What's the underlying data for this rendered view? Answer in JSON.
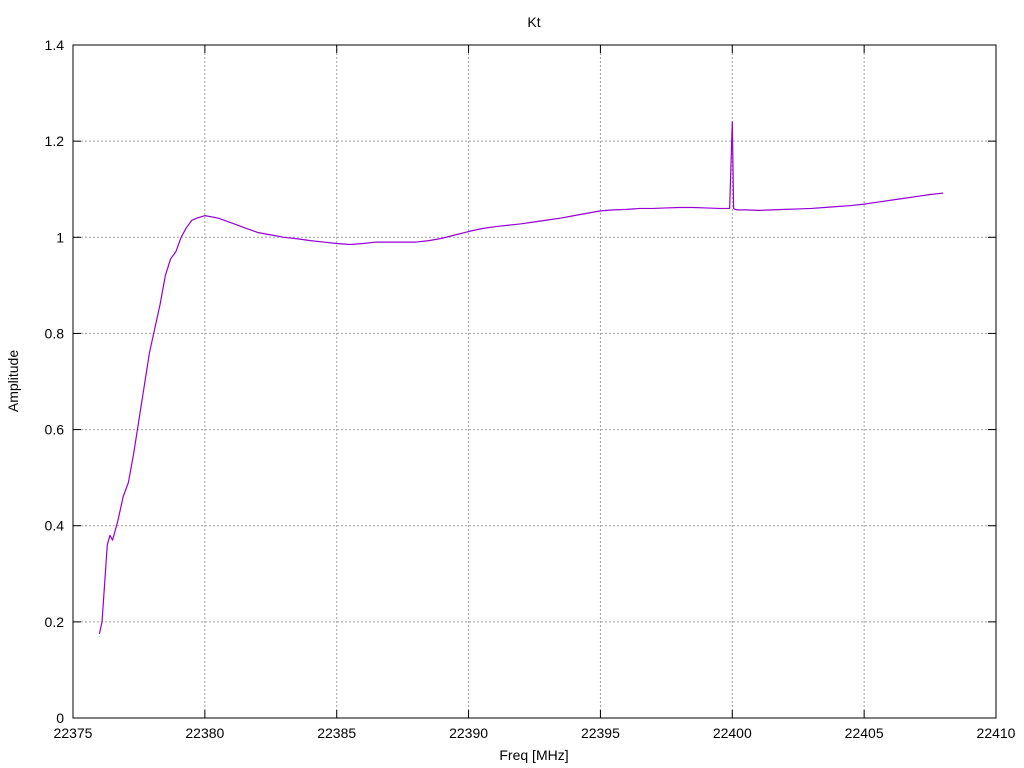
{
  "chart_data": {
    "type": "line",
    "title": "Kt",
    "xlabel": "Freq [MHz]",
    "ylabel": "Amplitude",
    "xlim": [
      22375,
      22410
    ],
    "ylim": [
      0,
      1.4
    ],
    "xticks": [
      "22375",
      "22380",
      "22385",
      "22390",
      "22395",
      "22400",
      "22405",
      "22410"
    ],
    "yticks": [
      "0",
      "0.2",
      "0.4",
      "0.6",
      "0.8",
      "1",
      "1.2",
      "1.4"
    ],
    "xtick_values": [
      22375,
      22380,
      22385,
      22390,
      22395,
      22400,
      22405,
      22410
    ],
    "ytick_values": [
      0,
      0.2,
      0.4,
      0.6,
      0.8,
      1.0,
      1.2,
      1.4
    ],
    "grid": true,
    "line_color": "#9400d3",
    "series": [
      {
        "x": [
          22376.0,
          22376.1,
          22376.2,
          22376.3,
          22376.4,
          22376.5,
          22376.7,
          22376.9,
          22377.1,
          22377.3,
          22377.5,
          22377.7,
          22377.9,
          22378.1,
          22378.3,
          22378.5,
          22378.7,
          22378.9,
          22379.1,
          22379.3,
          22379.5,
          22379.7,
          22380.0,
          22380.5,
          22381.0,
          22381.5,
          22382.0,
          22382.5,
          22383.0,
          22383.5,
          22384.0,
          22384.5,
          22385.0,
          22385.5,
          22386.0,
          22386.5,
          22387.0,
          22387.5,
          22388.0,
          22388.5,
          22389.0,
          22389.5,
          22390.0,
          22390.5,
          22391.0,
          22391.5,
          22392.0,
          22392.5,
          22393.0,
          22393.5,
          22394.0,
          22394.5,
          22395.0,
          22395.5,
          22396.0,
          22396.5,
          22397.0,
          22397.5,
          22398.0,
          22398.5,
          22399.0,
          22399.5,
          22399.9,
          22400.0,
          22400.05,
          22400.1,
          22400.2,
          22400.5,
          22401.0,
          22401.5,
          22402.0,
          22402.5,
          22403.0,
          22403.5,
          22404.0,
          22404.5,
          22405.0,
          22405.5,
          22406.0,
          22406.5,
          22407.0,
          22407.5,
          22408.0
        ],
        "y": [
          0.175,
          0.2,
          0.28,
          0.36,
          0.38,
          0.37,
          0.41,
          0.46,
          0.49,
          0.55,
          0.62,
          0.69,
          0.76,
          0.81,
          0.86,
          0.92,
          0.955,
          0.97,
          1.0,
          1.02,
          1.035,
          1.04,
          1.045,
          1.04,
          1.03,
          1.02,
          1.01,
          1.005,
          1.0,
          0.997,
          0.993,
          0.99,
          0.987,
          0.985,
          0.987,
          0.99,
          0.99,
          0.99,
          0.99,
          0.993,
          0.998,
          1.005,
          1.012,
          1.018,
          1.022,
          1.025,
          1.028,
          1.032,
          1.036,
          1.04,
          1.045,
          1.05,
          1.055,
          1.057,
          1.058,
          1.06,
          1.06,
          1.061,
          1.062,
          1.062,
          1.061,
          1.06,
          1.06,
          1.24,
          1.06,
          1.058,
          1.057,
          1.057,
          1.056,
          1.057,
          1.058,
          1.059,
          1.06,
          1.062,
          1.064,
          1.066,
          1.069,
          1.073,
          1.077,
          1.081,
          1.085,
          1.089,
          1.092
        ]
      }
    ]
  }
}
